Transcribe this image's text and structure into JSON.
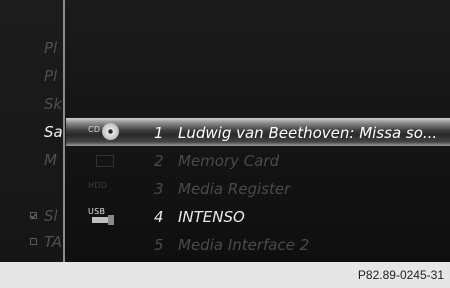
{
  "left_menu": {
    "items": [
      {
        "label": "Pl",
        "state": "dim"
      },
      {
        "label": "Pl",
        "state": "dim"
      },
      {
        "label": "Sk",
        "state": "dim"
      },
      {
        "label": "Sa",
        "state": "active"
      },
      {
        "label": "M",
        "state": "dim"
      },
      {
        "label": "",
        "state": "faint"
      },
      {
        "label": "Sl",
        "state": "dim",
        "checkbox": "checked"
      },
      {
        "label": "TA",
        "state": "dim",
        "checkbox": "unchecked"
      }
    ]
  },
  "media_list": {
    "items": [
      {
        "number": "1",
        "label": "Ludwig van Beethoven: Missa so...",
        "source_icon": "CD",
        "selected": true
      },
      {
        "number": "2",
        "label": "Memory Card",
        "source_icon": "",
        "selected": false
      },
      {
        "number": "3",
        "label": "Media Register",
        "source_icon": "HDD",
        "selected": false
      },
      {
        "number": "4",
        "label": "INTENSO",
        "source_icon": "USB",
        "selected": false
      },
      {
        "number": "5",
        "label": "Media Interface 2",
        "source_icon": "",
        "selected": false
      }
    ]
  },
  "footer": {
    "reference": "P82.89-0245-31"
  },
  "colors": {
    "screen_bg": "#151515",
    "active_text": "#ffffff",
    "dim_text": "#4a4a4a",
    "divider": "#8c8c8c"
  }
}
